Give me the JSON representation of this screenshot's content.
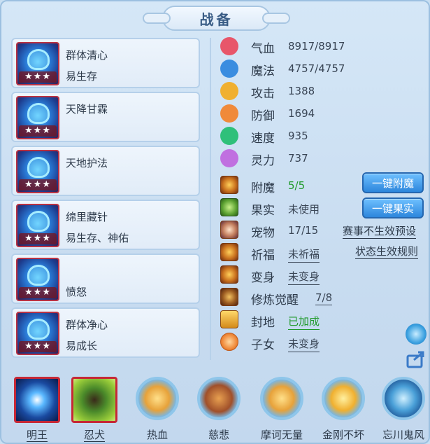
{
  "title": "战备",
  "skills": [
    {
      "name": "群体清心",
      "sub": "易生存",
      "stars": "★★★"
    },
    {
      "name": "天降甘霖",
      "sub": "",
      "stars": "★★★"
    },
    {
      "name": "天地护法",
      "sub": "",
      "stars": "★★★"
    },
    {
      "name": "绵里藏针",
      "sub": "易生存、神佑",
      "stars": "★★★"
    },
    {
      "name": "",
      "sub": "愤怒",
      "stars": "★★★"
    },
    {
      "name": "群体净心",
      "sub": "易成长",
      "stars": "★★★"
    }
  ],
  "stats": [
    {
      "label": "气血",
      "value": "8917/8917",
      "icon": "heart-icon",
      "color": "#e8566a"
    },
    {
      "label": "魔法",
      "value": "4757/4757",
      "icon": "mana-icon",
      "color": "#3a8de0"
    },
    {
      "label": "攻击",
      "value": "1388",
      "icon": "sword-icon",
      "color": "#f0b030"
    },
    {
      "label": "防御",
      "value": "1694",
      "icon": "shield-icon",
      "color": "#f08a3a"
    },
    {
      "label": "速度",
      "value": "935",
      "icon": "speed-icon",
      "color": "#2fc07a"
    },
    {
      "label": "灵力",
      "value": "737",
      "icon": "spirit-icon",
      "color": "#c070e0"
    }
  ],
  "rows": [
    {
      "label": "附魔",
      "value": "5/5",
      "icon": "enchant-icon"
    },
    {
      "label": "果实",
      "value": "未使用",
      "icon": "fruit-icon"
    },
    {
      "label": "宠物",
      "value": "17/15",
      "icon": "pet-icon"
    },
    {
      "label": "祈福",
      "value": "未祈福",
      "icon": "blessing-icon"
    },
    {
      "label": "变身",
      "value": "未变身",
      "icon": "transform-icon"
    },
    {
      "label": "修炼觉醒",
      "value": "7/8",
      "icon": "cultivation-icon"
    },
    {
      "label": "封地",
      "value": "已加成",
      "icon": "fief-icon"
    },
    {
      "label": "子女",
      "value": "未变身",
      "icon": "children-icon"
    }
  ],
  "buttons": {
    "enchant": "一键附魔",
    "fruit": "一键果实"
  },
  "links": {
    "event_preset": "赛事不生效预设",
    "state_rule": "状态生效规则"
  },
  "pets": [
    {
      "name": "明王",
      "style": "square"
    },
    {
      "name": "忍犬",
      "style": "square"
    },
    {
      "name": "热血",
      "style": "round"
    },
    {
      "name": "慈悲",
      "style": "round"
    },
    {
      "name": "摩诃无量",
      "style": "round"
    },
    {
      "name": "金刚不坏",
      "style": "round"
    },
    {
      "name": "忘川鬼风",
      "style": "round"
    }
  ]
}
